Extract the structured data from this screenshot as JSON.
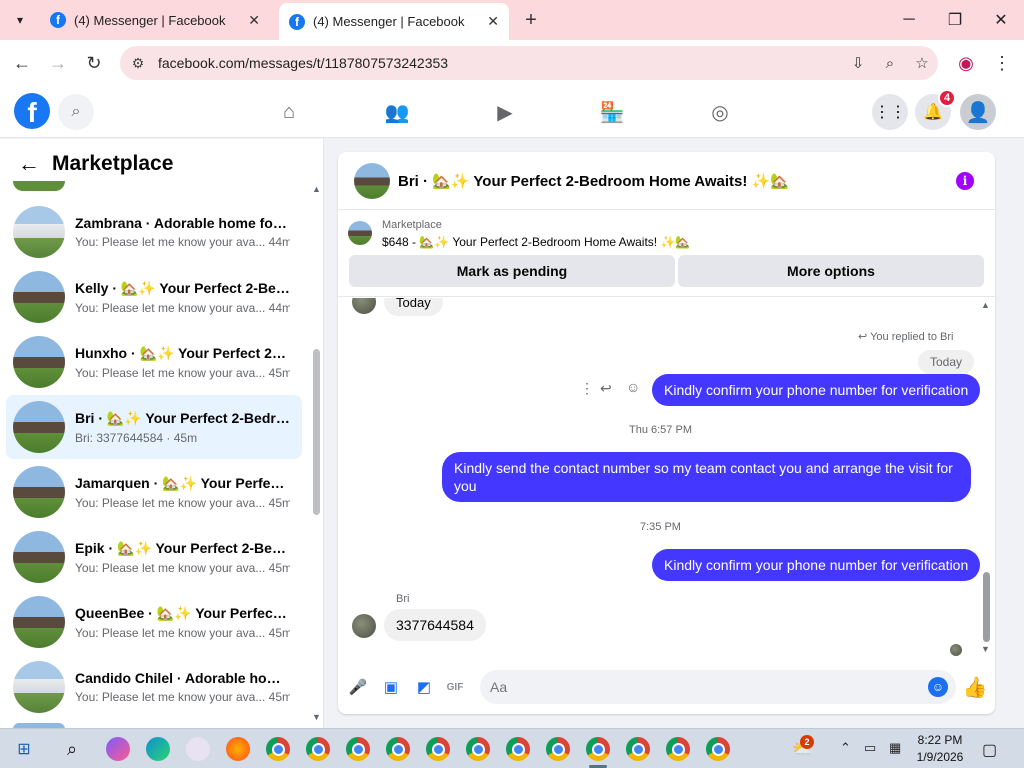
{
  "browser": {
    "tabs": [
      {
        "title": "(4) Messenger | Facebook",
        "active": false
      },
      {
        "title": "(4) Messenger | Facebook",
        "active": true
      }
    ],
    "url": "facebook.com/messages/t/1187807573242353",
    "icons": {
      "tab_dropdown": "chevron-down-icon",
      "new_tab": "plus-icon",
      "back": "arrow-left-icon",
      "forward": "arrow-right-icon",
      "reload": "reload-icon",
      "site_info": "tune-icon",
      "install": "install-icon",
      "zoom": "zoom-icon",
      "bookmark": "star-icon"
    }
  },
  "fb": {
    "logo": "f",
    "notifications_count": "4"
  },
  "sidebar": {
    "title": "Marketplace",
    "conversations": [
      {
        "name": "Zambrana · Adorable home for ...",
        "preview": "You: Please let me know your ava... 44m",
        "thumb": "white",
        "active": false
      },
      {
        "name": "Kelly · 🏡✨ Your Perfect 2-Bedr...",
        "preview": "You: Please let me know your ava... 44m",
        "thumb": "brick",
        "active": false
      },
      {
        "name": "Hunxho · 🏡✨ Your Perfect 2-B...",
        "preview": "You: Please let me know your ava... 45m",
        "thumb": "brick",
        "active": false
      },
      {
        "name": "Bri · 🏡✨ Your Perfect 2-Bedro...",
        "preview": "Bri: 3377644584 · 45m",
        "thumb": "brick",
        "active": true
      },
      {
        "name": "Jamarquen · 🏡✨ Your Perfect ...",
        "preview": "You: Please let me know your ava... 45m",
        "thumb": "brick",
        "active": false
      },
      {
        "name": "Epik · 🏡✨ Your Perfect 2-Bedr...",
        "preview": "You: Please let me know your ava... 45m",
        "thumb": "brick",
        "active": false
      },
      {
        "name": "QueenBee · 🏡✨ Your Perfect 2...",
        "preview": "You: Please let me know your ava... 45m",
        "thumb": "brick",
        "active": false
      },
      {
        "name": "Candido Chilel · Adorable home...",
        "preview": "You: Please let me know your ava... 45m",
        "thumb": "white",
        "active": false
      }
    ]
  },
  "chat": {
    "title": "Bri · 🏡✨ Your Perfect 2-Bedroom Home Awaits! ✨🏡",
    "marketplace_label": "Marketplace",
    "listing": "$648 - 🏡✨ Your Perfect 2-Bedroom Home Awaits! ✨🏡",
    "mark_pending": "Mark as pending",
    "more_options": "More options",
    "messages": {
      "reply_preview_in": "Today",
      "replied_note": "You replied to Bri",
      "replied_quote": "Today",
      "out_1": "Kindly confirm your phone number for verification",
      "time_1": "Thu 6:57 PM",
      "out_2": "Kindly send the contact number so my team contact you and arrange the visit for you",
      "time_2": "7:35 PM",
      "out_3": "Kindly confirm your phone number for verification",
      "sender_name": "Bri",
      "in_1": "3377644584"
    },
    "composer_placeholder": "Aa"
  },
  "taskbar": {
    "time": "8:22 PM",
    "date": "1/9/2026",
    "weather_badge": "2"
  }
}
